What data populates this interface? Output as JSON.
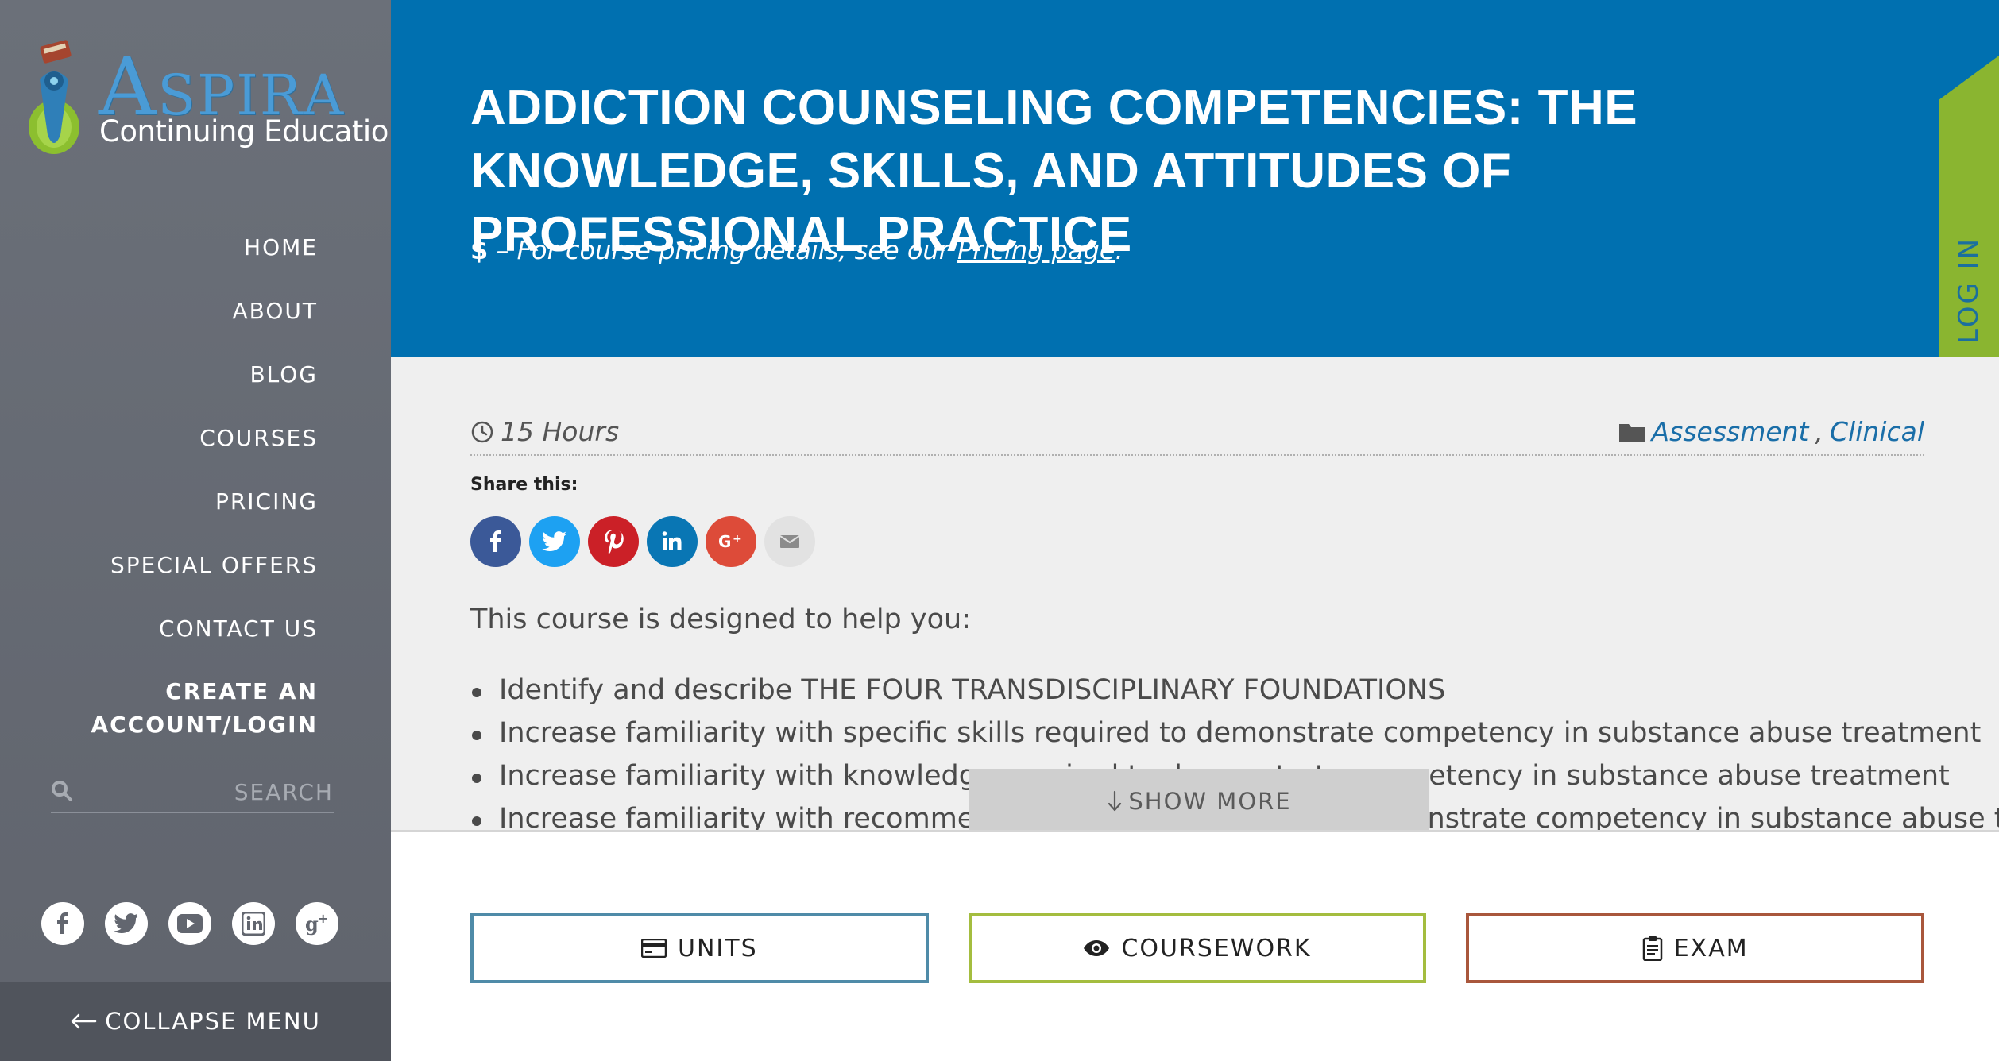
{
  "brand": {
    "name": "Aspira",
    "tagline": "Continuing Education",
    "colors": {
      "sidebar": "#65696f",
      "header": "#0070b0",
      "login_tab": "#8ab530",
      "link": "#1a6ea8"
    }
  },
  "nav": {
    "items": [
      "HOME",
      "ABOUT",
      "BLOG",
      "COURSES",
      "PRICING",
      "SPECIAL OFFERS",
      "CONTACT US"
    ],
    "account_line1": "CREATE AN",
    "account_line2": "ACCOUNT/LOGIN"
  },
  "search": {
    "placeholder": "SEARCH"
  },
  "social": [
    "facebook-icon",
    "twitter-icon",
    "youtube-icon",
    "linkedin-icon",
    "google-plus-icon"
  ],
  "collapse_label": "COLLAPSE MENU",
  "header": {
    "title": "ADDICTION COUNSELING COMPETENCIES: THE KNOWLEDGE, SKILLS, AND ATTITUDES OF PROFESSIONAL PRACTICE",
    "pricing_symbol": "$",
    "pricing_text": " – For course pricing details, see our ",
    "pricing_link": "Pricing page",
    "pricing_end": "."
  },
  "login_label": "LOG IN",
  "course": {
    "hours": "15 Hours",
    "categories": [
      "Assessment",
      "Clinical"
    ],
    "category_sep": ",",
    "share_label": "Share this:",
    "share": [
      {
        "name": "facebook",
        "color": "#3b5998"
      },
      {
        "name": "twitter",
        "color": "#1da1f2"
      },
      {
        "name": "pinterest",
        "color": "#cb2027"
      },
      {
        "name": "linkedin",
        "color": "#0976b4"
      },
      {
        "name": "google-plus",
        "color": "#dd4b39"
      },
      {
        "name": "email",
        "color": "#e2e2e2"
      }
    ],
    "intro": "This course is designed to help you:",
    "bullets": [
      "Identify and describe THE FOUR TRANSDISCIPLINARY FOUNDATIONS",
      "Increase familiarity with specific skills required to demonstrate competency in substance abuse treatment",
      "Increase familiarity with knowledge required to demonstrate competency in substance abuse treatment",
      "Increase familiarity with recommended attitudes required to demonstrate competency in substance abuse treatment"
    ],
    "show_more": "SHOW MORE"
  },
  "tabs": {
    "units": "UNITS",
    "coursework": "COURSEWORK",
    "exam": "EXAM"
  }
}
